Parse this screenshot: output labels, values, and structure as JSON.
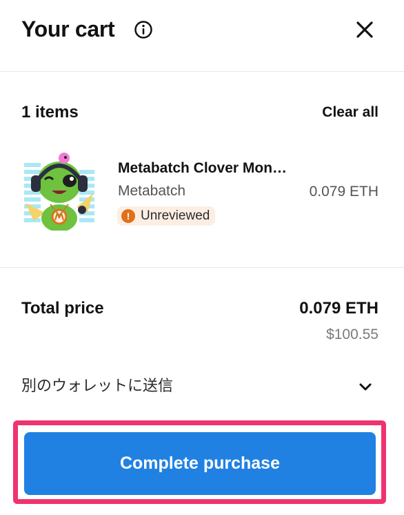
{
  "header": {
    "title": "Your cart"
  },
  "items_header": {
    "count_label": "1 items",
    "clear_all_label": "Clear all"
  },
  "cart_items": [
    {
      "name": "Metabatch Clover Monster",
      "collection": "Metabatch",
      "price": "0.079 ETH",
      "badge": "Unreviewed"
    }
  ],
  "total": {
    "label": "Total price",
    "eth": "0.079 ETH",
    "usd": "$100.55"
  },
  "send_to_other_wallet": {
    "label": "別のウォレットに送信"
  },
  "purchase": {
    "button_label": "Complete purchase"
  },
  "colors": {
    "primary_button": "#2081e2",
    "highlight_border": "#f0336e",
    "warning_badge": "#e0701a",
    "badge_background": "#fdeee4"
  },
  "icons": {
    "info": "info-circle-icon",
    "close": "close-icon",
    "warning": "exclamation-icon",
    "chevron": "chevron-down-icon"
  }
}
